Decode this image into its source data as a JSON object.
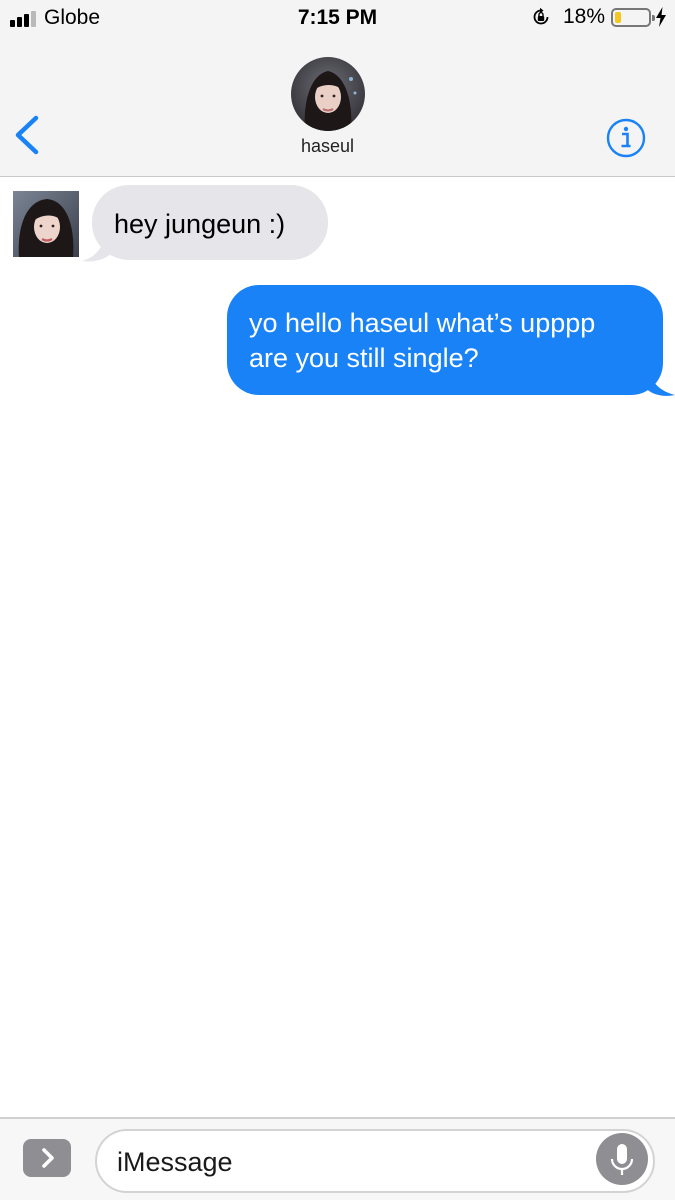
{
  "status_bar": {
    "carrier": "Globe",
    "time": "7:15 PM",
    "battery_percent": "18%",
    "battery_level": 0.18,
    "signal_bars": 3,
    "icons": [
      "signal-bars-icon",
      "orientation-lock-icon",
      "battery-icon",
      "charging-bolt-icon"
    ]
  },
  "header": {
    "contact_name": "haseul",
    "back_icon": "chevron-left-icon",
    "info_icon": "info-icon"
  },
  "messages": [
    {
      "direction": "incoming",
      "lines": [
        "hey jungeun :)"
      ]
    },
    {
      "direction": "outgoing",
      "lines": [
        "yo hello haseul what’s upppp",
        "are you still single?"
      ]
    }
  ],
  "input_bar": {
    "placeholder": "iMessage",
    "expand_icon": "chevron-right-icon",
    "mic_icon": "microphone-icon"
  },
  "colors": {
    "accent": "#1a82f7",
    "incoming_bubble": "#e5e5ea",
    "bar_background": "#f4f4f4",
    "battery_fill": "#f3c71f"
  }
}
